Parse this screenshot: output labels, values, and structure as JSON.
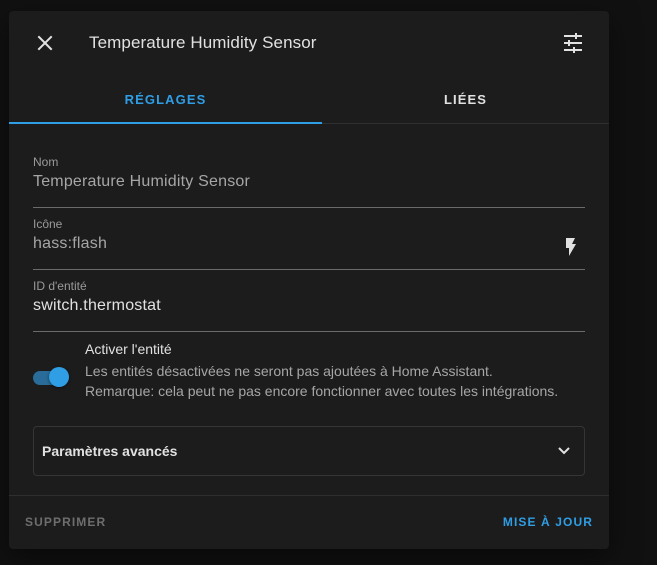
{
  "dialog": {
    "title": "Temperature Humidity Sensor",
    "close_icon": "close-icon",
    "settings_icon": "tune-icon"
  },
  "tabs": [
    {
      "label": "RÉGLAGES",
      "active": true
    },
    {
      "label": "LIÉES",
      "active": false
    }
  ],
  "fields": {
    "name": {
      "label": "Nom",
      "placeholder": "Temperature Humidity Sensor",
      "value": ""
    },
    "icon": {
      "label": "Icône",
      "placeholder": "hass:flash",
      "value": "",
      "icon": "flash-icon"
    },
    "entity_id": {
      "label": "ID d'entité",
      "value": "switch.thermostat"
    }
  },
  "enable_entity": {
    "title": "Activer l'entité",
    "description": "Les entités désactivées ne seront pas ajoutées à Home Assistant. Remarque: cela peut ne pas encore fonctionner avec toutes les intégrations.",
    "enabled": true
  },
  "advanced": {
    "label": "Paramètres avancés",
    "icon": "chevron-down-icon"
  },
  "footer": {
    "delete_label": "SUPPRIMER",
    "update_label": "MISE À JOUR"
  },
  "colors": {
    "accent": "#2f9ee5",
    "background": "#1c1c1c",
    "page_background": "#111111"
  }
}
